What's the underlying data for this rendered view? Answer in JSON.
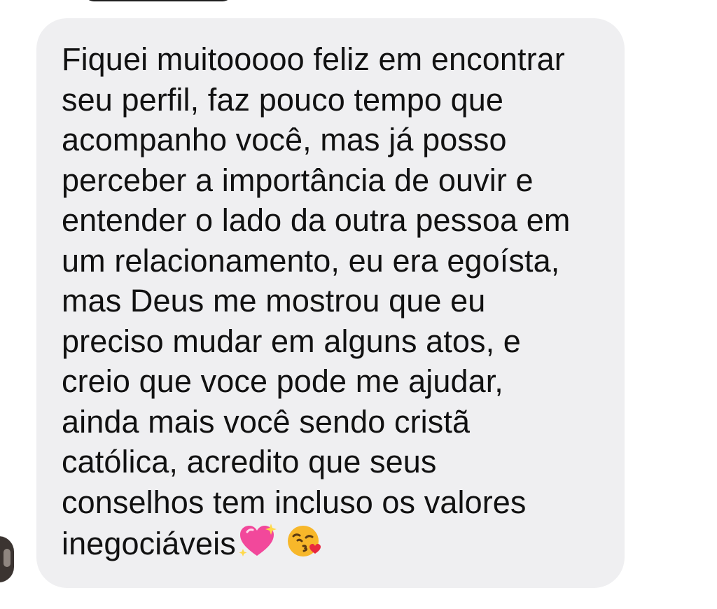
{
  "message": {
    "lines": [
      "Fiquei muitooooo feliz em encontrar",
      "seu perfil, faz pouco tempo que",
      "acompanho você, mas já posso",
      "perceber a importância de ouvir e",
      "entender o lado da outra pessoa em",
      "um relacionamento, eu era egoísta,",
      "mas Deus me mostrou que eu",
      "preciso mudar em alguns atos, e",
      "creio que voce pode me ajudar,",
      "ainda mais você sendo cristã",
      "católica, acredito que seus",
      "conselhos tem incluso os valores",
      "inegociáveis"
    ],
    "emojis": [
      "sparkling-heart-icon",
      "face-blowing-kiss-icon"
    ]
  },
  "colors": {
    "bubble": "#efeff1",
    "text": "#111111",
    "heart": "#f2489b",
    "kiss_face": "#f7b72a"
  }
}
